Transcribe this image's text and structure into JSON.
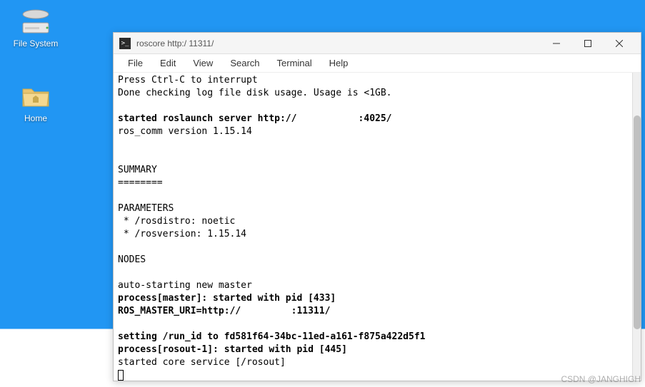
{
  "desktop": {
    "filesystem_label": "File System",
    "home_label": "Home"
  },
  "window": {
    "title": "roscore http:/           11311/"
  },
  "menu": {
    "file": "File",
    "edit": "Edit",
    "view": "View",
    "search": "Search",
    "terminal": "Terminal",
    "help": "Help"
  },
  "terminal": {
    "l0": "Press Ctrl-C to interrupt",
    "l1": "Done checking log file disk usage. Usage is <1GB.",
    "l2": "",
    "l3": "started roslaunch server http://           :4025/",
    "l4": "ros_comm version 1.15.14",
    "l5": "",
    "l6": "",
    "l7": "SUMMARY",
    "l8": "========",
    "l9": "",
    "l10": "PARAMETERS",
    "l11": " * /rosdistro: noetic",
    "l12": " * /rosversion: 1.15.14",
    "l13": "",
    "l14": "NODES",
    "l15": "",
    "l16": "auto-starting new master",
    "l17": "process[master]: started with pid [433]",
    "l18": "ROS_MASTER_URI=http://         :11311/",
    "l19": "",
    "l20": "setting /run_id to fd581f64-34bc-11ed-a161-f875a422d5f1",
    "l21": "process[rosout-1]: started with pid [445]",
    "l22": "started core service [/rosout]"
  },
  "watermark": "CSDN @JANGHIGH"
}
